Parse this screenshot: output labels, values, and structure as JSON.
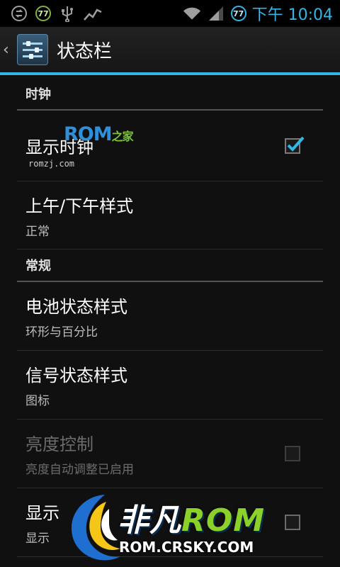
{
  "status_bar": {
    "time": "下午 10:04",
    "battery_level_left": "77",
    "battery_level_right": "77",
    "left_icons": [
      "sync-icon",
      "battery-badge-icon",
      "usb-icon",
      "activity-icon"
    ],
    "right_icons": [
      "wifi-icon",
      "signal-icon",
      "battery-badge-icon"
    ]
  },
  "action_bar": {
    "title": "状态栏",
    "icon": "settings-sliders-icon"
  },
  "sections": {
    "clock_header": "时钟",
    "general_header": "常规"
  },
  "items": {
    "show_clock": {
      "title": "显示时钟",
      "checked": true
    },
    "ampm": {
      "title": "上午/下午样式",
      "summary": "正常"
    },
    "battery": {
      "title": "电池状态样式",
      "summary": "环形与百分比"
    },
    "signal": {
      "title": "信号状态样式",
      "summary": "图标"
    },
    "brightness": {
      "title": "亮度控制",
      "summary": "亮度自动调整已启用",
      "checked": false,
      "enabled": false
    },
    "show_notif": {
      "title": "显示",
      "summary": "显示",
      "checked": false
    }
  },
  "watermarks": {
    "romzj_logo": "ROM",
    "romzj_logo_suffix": "之家",
    "romzj_url": "romzj.com",
    "crsky_logo": "非凡",
    "crsky_logo_rom": "ROM",
    "crsky_url": "ROM.CRSKY.COM"
  },
  "colors": {
    "accent": "#33b5e5",
    "background": "#101010"
  }
}
